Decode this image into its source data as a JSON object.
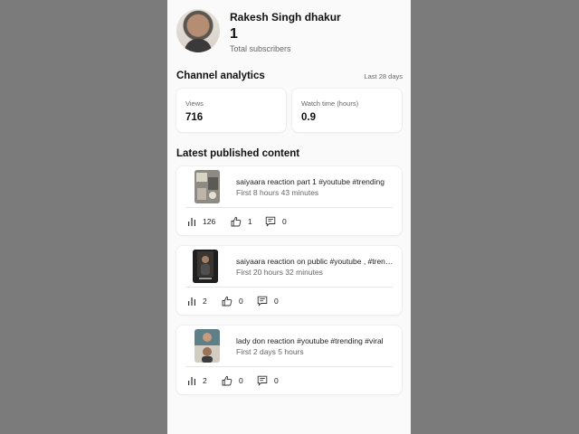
{
  "channel": {
    "name": "Rakesh Singh dhakur",
    "subscriber_count": "1",
    "subscriber_label": "Total subscribers"
  },
  "analytics": {
    "title": "Channel analytics",
    "period": "Last 28 days",
    "metrics": [
      {
        "label": "Views",
        "value": "716"
      },
      {
        "label": "Watch time (hours)",
        "value": "0.9"
      }
    ]
  },
  "latest": {
    "title": "Latest published content",
    "videos": [
      {
        "title": "saiyaara reaction part 1 #youtube #trending",
        "period": "First 8 hours 43 minutes",
        "views": "126",
        "likes": "1",
        "comments": "0"
      },
      {
        "title": "saiyaara reaction on public #youtube , #trending",
        "period": "First 20 hours 32 minutes",
        "views": "2",
        "likes": "0",
        "comments": "0"
      },
      {
        "title": "lady don reaction #youtube #trending #viral",
        "period": "First 2 days 5 hours",
        "views": "2",
        "likes": "0",
        "comments": "0"
      }
    ]
  },
  "colors": {
    "page_bg": "#7b7b7b",
    "screen_bg": "#fafafa",
    "card_bg": "#ffffff"
  },
  "icons": [
    "views-bar-icon",
    "like-icon",
    "comment-icon"
  ]
}
